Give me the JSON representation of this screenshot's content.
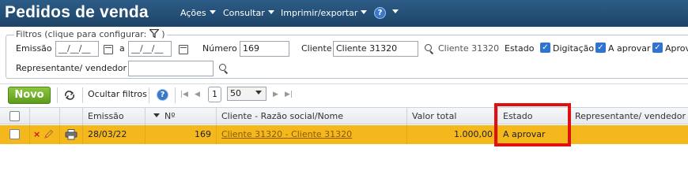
{
  "header": {
    "title": "Pedidos de venda",
    "menus": [
      {
        "label": "Ações"
      },
      {
        "label": "Consultar"
      },
      {
        "label": "Imprimir/exportar"
      }
    ],
    "help_icon": "?"
  },
  "filters": {
    "legend": "Filtros (clique para configurar:",
    "legend_close": ")",
    "emissao_label": "Emissão",
    "emissao_from": "__/__/__",
    "range_sep": "a",
    "emissao_to": "__/__/__",
    "numero_label": "Número",
    "numero_value": "169",
    "cliente_label": "Cliente",
    "cliente_value": "Cliente 31320",
    "cliente_name": "Cliente 31320",
    "estado_label": "Estado",
    "estado_options": [
      {
        "label": "Digitação",
        "checked": true
      },
      {
        "label": "A aprovar",
        "checked": true
      },
      {
        "label": "Aprov",
        "checked": true
      }
    ],
    "representante_label": "Representante/ vendedor",
    "representante_value": ""
  },
  "toolbar": {
    "novo_label": "Novo",
    "ocultar_label": "Ocultar filtros",
    "help_icon": "?",
    "page_number": "1",
    "page_size": "50"
  },
  "table": {
    "columns": [
      "",
      "",
      "",
      "Emissão",
      "Nº",
      "Cliente - Razão social/Nome",
      "Valor total",
      "Estado",
      "Representante/ vendedor"
    ],
    "rows": [
      {
        "emissao": "28/03/22",
        "numero": "169",
        "cliente": "Cliente 31320 - Cliente 31320",
        "valor_total": "1.000,00",
        "estado": "A aprovar",
        "representante": ""
      }
    ]
  },
  "colors": {
    "header_bg": "#1e4468",
    "selected_row": "#f4b81c",
    "novo_green": "#6aa823",
    "highlight_box": "#e01010",
    "checkbox_blue": "#2f74d0"
  }
}
